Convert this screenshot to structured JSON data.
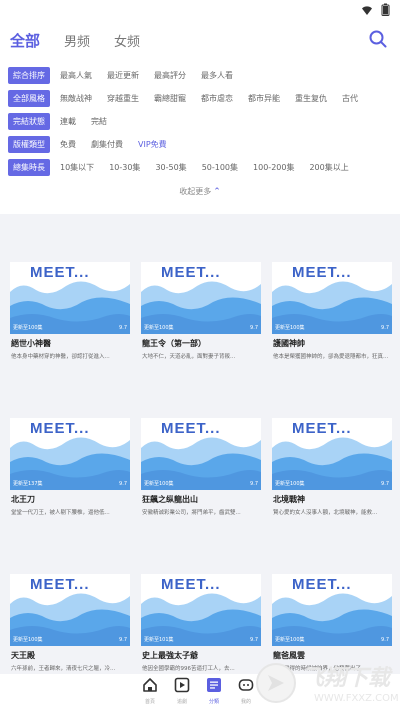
{
  "header": {
    "tabs": [
      "全部",
      "男频",
      "女频"
    ]
  },
  "filters": {
    "rows": [
      {
        "label": "綜合排序",
        "options": [
          "最高人氣",
          "最近更新",
          "最高評分",
          "最多人看"
        ],
        "selected": -1
      },
      {
        "label": "全部風格",
        "options": [
          "無敵战神",
          "穿越重生",
          "霸總甜寵",
          "都市虐恋",
          "都市异能",
          "重生复仇",
          "古代"
        ],
        "selected": -1
      },
      {
        "label": "完結狀態",
        "options": [
          "連載",
          "完結"
        ],
        "selected": -1
      },
      {
        "label": "版權類型",
        "options": [
          "免費",
          "劇集付費",
          "VIP免費"
        ],
        "selected": 2
      },
      {
        "label": "總集時長",
        "options": [
          "10集以下",
          "10-30集",
          "30-50集",
          "50-100集",
          "100-200集",
          "200集以上"
        ],
        "selected": -1
      }
    ],
    "collapse": "收起更多"
  },
  "cards": [
    {
      "cover_text": "MEET...",
      "count": "更新至100集",
      "score": "9.7",
      "title": "絕世小神醫",
      "desc": "他本身中藥材穿的神醫，卻認打從進入..."
    },
    {
      "cover_text": "MEET...",
      "count": "更新至100集",
      "score": "9.7",
      "title": "龍王令（第一部）",
      "desc": "大地不仁，天道必亂，面對妻子背叛..."
    },
    {
      "cover_text": "MEET...",
      "count": "更新至100集",
      "score": "9.7",
      "title": "護國神帥",
      "desc": "他本是榮獲國神帥的，卻為愛退隱都市，狂真..."
    },
    {
      "cover_text": "MEET...",
      "count": "更新至137集",
      "score": "9.7",
      "title": "北王刀",
      "desc": "堂堂一代刀王，被人剔下腰椎，逼他低..."
    },
    {
      "cover_text": "MEET...",
      "count": "更新至100集",
      "score": "9.7",
      "title": "狂飆之纵龍出山",
      "desc": "安徽精诚彩業公司，將門弟平，齒武雙..."
    },
    {
      "cover_text": "MEET...",
      "count": "更新至100集",
      "score": "9.7",
      "title": "北境戰神",
      "desc": "賢心愛的女人沒事人額，北境戰神，能救..."
    },
    {
      "cover_text": "MEET...",
      "count": "更新至100集",
      "score": "9.7",
      "title": "天王殿",
      "desc": "六年孫前，王者歸來，清夜七尺之軀，冷..."
    },
    {
      "cover_text": "MEET...",
      "count": "更新至101集",
      "score": "9.7",
      "title": "史上最強太子爺",
      "desc": "他因全國學霸的996苦逼打工人，去..."
    },
    {
      "cover_text": "MEET...",
      "count": "更新至100集",
      "score": "9.7",
      "title": "龍爸風雲",
      "desc": "我行醫得的時候被咱界，他發奮出了..."
    }
  ],
  "nav": [
    {
      "icon": "home-icon",
      "label": "首頁"
    },
    {
      "icon": "play-icon",
      "label": "追劇"
    },
    {
      "icon": "category-icon",
      "label": "分類"
    },
    {
      "icon": "profile-icon",
      "label": "我的"
    }
  ],
  "nav_active": 2,
  "watermark": {
    "brand": "飞翔下载",
    "url": "WWW.FXXZ.COM"
  },
  "colors": {
    "accent": "#5b5fe0",
    "label_bg": "#6569e4",
    "cover_wave_dark": "#5aa7ea",
    "cover_wave_light": "#a9d3f6"
  }
}
